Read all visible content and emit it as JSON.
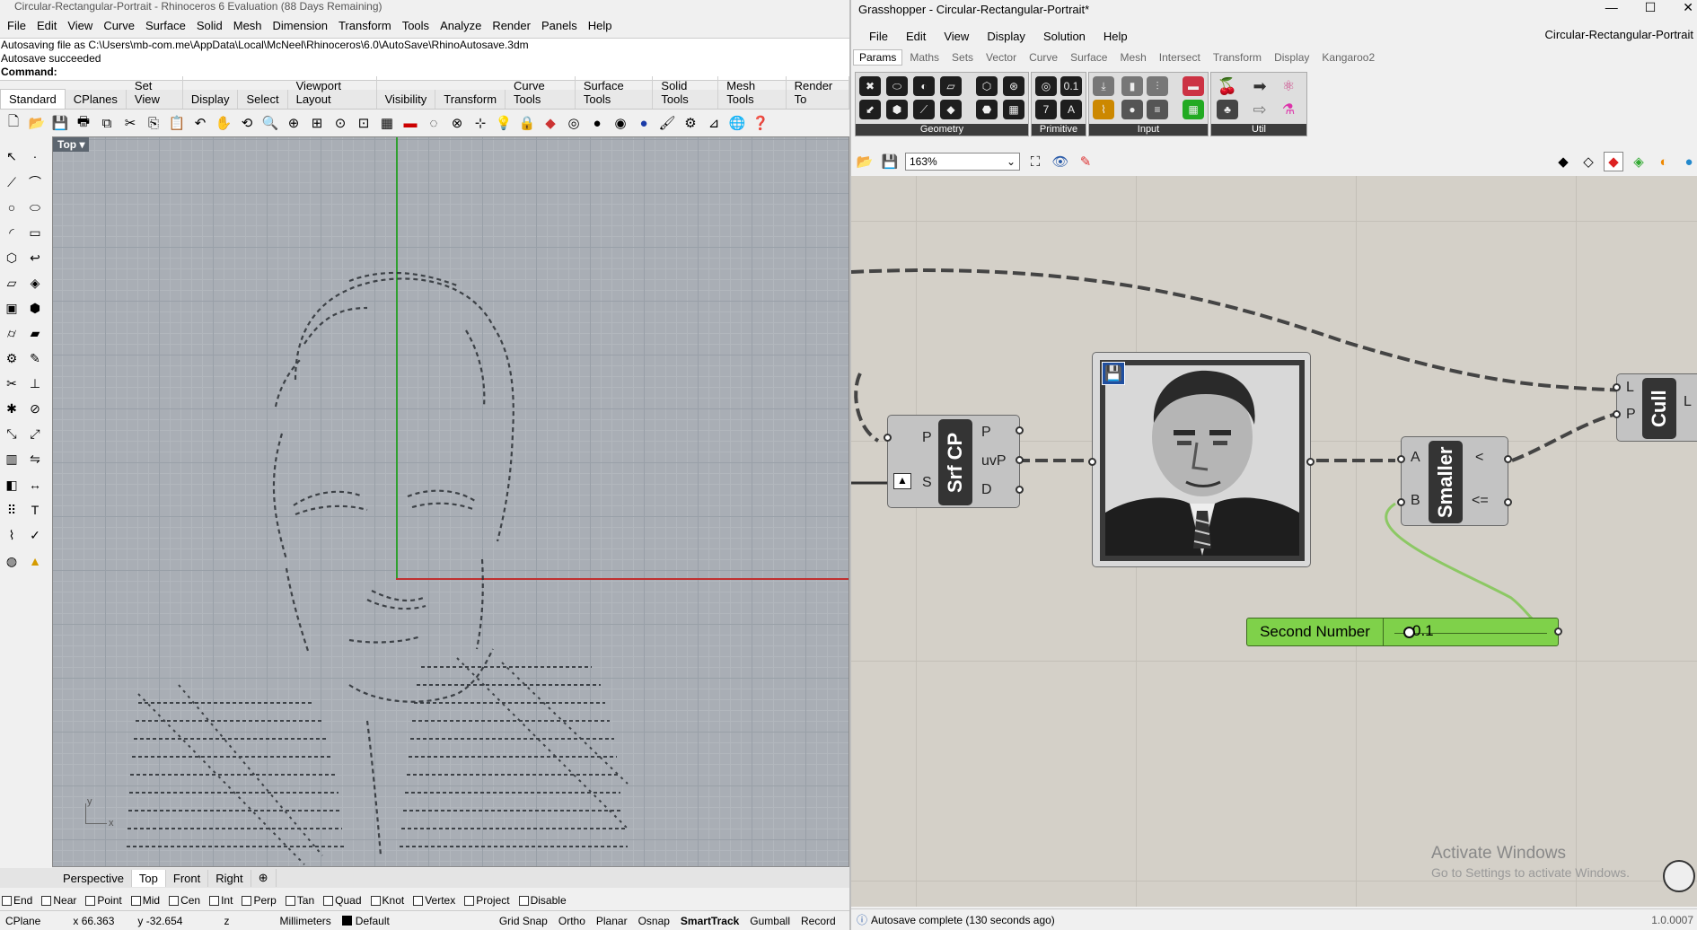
{
  "rhino": {
    "title": "Circular-Rectangular-Portrait - Rhinoceros 6 Evaluation (88 Days Remaining)",
    "menu": [
      "File",
      "Edit",
      "View",
      "Curve",
      "Surface",
      "Solid",
      "Mesh",
      "Dimension",
      "Transform",
      "Tools",
      "Analyze",
      "Render",
      "Panels",
      "Help"
    ],
    "messages": [
      "Autosaving file as C:\\Users\\mb-com.me\\AppData\\Local\\McNeel\\Rhinoceros\\6.0\\AutoSave\\RhinoAutosave.3dm",
      "Autosave succeeded"
    ],
    "command_label": "Command:",
    "toolbar_tabs": [
      "Standard",
      "CPlanes",
      "Set View",
      "Display",
      "Select",
      "Viewport Layout",
      "Visibility",
      "Transform",
      "Curve Tools",
      "Surface Tools",
      "Solid Tools",
      "Mesh Tools",
      "Render To"
    ],
    "viewport_name": "Top",
    "viewport_tabs": [
      "Perspective",
      "Top",
      "Front",
      "Right"
    ],
    "osnaps": [
      "End",
      "Near",
      "Point",
      "Mid",
      "Cen",
      "Int",
      "Perp",
      "Tan",
      "Quad",
      "Knot",
      "Vertex",
      "Project",
      "Disable"
    ],
    "axis_labels": {
      "x": "x",
      "y": "y"
    },
    "status": {
      "cplane": "CPlane",
      "x": "x 66.363",
      "y": "y -32.654",
      "z": "z",
      "units": "Millimeters",
      "layer": "Default",
      "toggles": [
        "Grid Snap",
        "Ortho",
        "Planar",
        "Osnap",
        "SmartTrack",
        "Gumball",
        "Record"
      ]
    }
  },
  "gh": {
    "title": "Grasshopper - Circular-Rectangular-Portrait*",
    "doc_name": "Circular-Rectangular-Portrait",
    "menu": [
      "File",
      "Edit",
      "View",
      "Display",
      "Solution",
      "Help"
    ],
    "tabs": [
      "Params",
      "Maths",
      "Sets",
      "Vector",
      "Curve",
      "Surface",
      "Mesh",
      "Intersect",
      "Transform",
      "Display",
      "Kangaroo2"
    ],
    "ribbon_groups": [
      "Geometry",
      "Primitive",
      "Input",
      "Util"
    ],
    "zoom": "163%",
    "nodes": {
      "srfcp": {
        "title": "Srf CP",
        "inputs": [
          "P",
          "S"
        ],
        "outputs": [
          "P",
          "uvP",
          "D"
        ]
      },
      "smaller": {
        "title": "Smaller",
        "inputs": [
          "A",
          "B"
        ],
        "outputs": [
          "<",
          "<="
        ]
      },
      "cull": {
        "title": "Cull",
        "inputs": [
          "L",
          "P"
        ],
        "outputs": [
          "L"
        ]
      }
    },
    "slider": {
      "label": "Second Number",
      "value": "0.1",
      "fill_fraction": 0.1
    },
    "watermark": [
      "Activate Windows",
      "Go to Settings to activate Windows."
    ],
    "status_text": "Autosave complete (130 seconds ago)",
    "version": "1.0.0007"
  },
  "colors": {
    "slider_green": "#7fd14a",
    "wire_green": "#8cc864",
    "node_grey": "#c3c3c3",
    "x_axis": "#c83232",
    "y_axis": "#32a032"
  }
}
